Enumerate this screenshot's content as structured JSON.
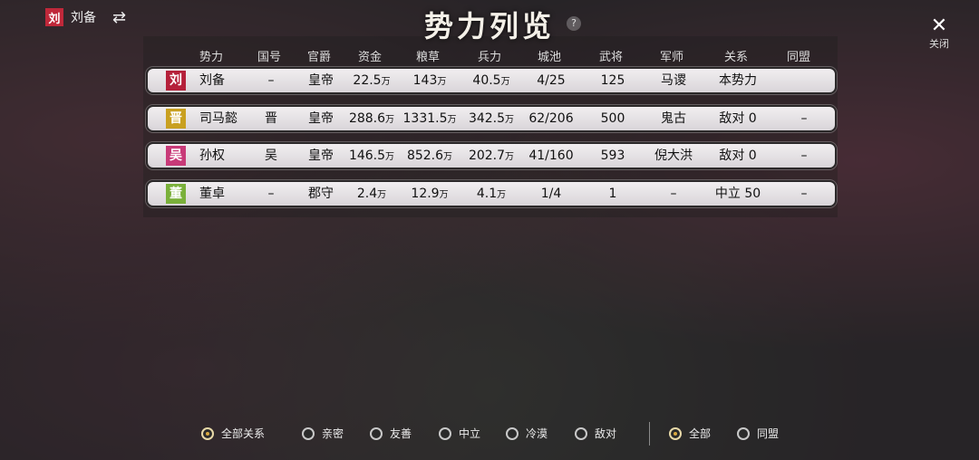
{
  "player": {
    "seal": "刘",
    "name": "刘备",
    "seal_color": "#c0283a",
    "swap_icon": "⇄"
  },
  "title": "势力列览",
  "help_icon": "?",
  "close": {
    "icon": "✕",
    "label": "关闭"
  },
  "columns": [
    "势力",
    "国号",
    "官爵",
    "资金",
    "粮草",
    "兵力",
    "城池",
    "武将",
    "军师",
    "关系",
    "同盟"
  ],
  "rows": [
    {
      "seal": "刘",
      "seal_color": "#b5203a",
      "name": "刘备",
      "country": "–",
      "rank": "皇帝",
      "funds": "22.5",
      "food": "143",
      "troops": "40.5",
      "cities": "4/25",
      "generals": "125",
      "advisor": "马谡",
      "relation": "本势力",
      "ally": ""
    },
    {
      "seal": "晋",
      "seal_color": "#c9a020",
      "name": "司马懿",
      "country": "晋",
      "rank": "皇帝",
      "funds": "288.6",
      "food": "1331.5",
      "troops": "342.5",
      "cities": "62/206",
      "generals": "500",
      "advisor": "鬼古",
      "relation": "敌对 0",
      "ally": "–"
    },
    {
      "seal": "吴",
      "seal_color": "#c83a78",
      "name": "孙权",
      "country": "吴",
      "rank": "皇帝",
      "funds": "146.5",
      "food": "852.6",
      "troops": "202.7",
      "cities": "41/160",
      "generals": "593",
      "advisor": "倪大洪",
      "relation": "敌对 0",
      "ally": "–"
    },
    {
      "seal": "董",
      "seal_color": "#7ab03a",
      "name": "董卓",
      "country": "–",
      "rank": "郡守",
      "funds": "2.4",
      "food": "12.9",
      "troops": "4.1",
      "cities": "1/4",
      "generals": "1",
      "advisor": "–",
      "relation": "中立 50",
      "ally": "–"
    }
  ],
  "unit": "万",
  "relation_filters": [
    {
      "label": "全部关系",
      "selected": true
    },
    {
      "label": "亲密",
      "selected": false
    },
    {
      "label": "友善",
      "selected": false
    },
    {
      "label": "中立",
      "selected": false
    },
    {
      "label": "冷漠",
      "selected": false
    },
    {
      "label": "敌对",
      "selected": false
    }
  ],
  "scope_filters": [
    {
      "label": "全部",
      "selected": true
    },
    {
      "label": "同盟",
      "selected": false
    }
  ]
}
